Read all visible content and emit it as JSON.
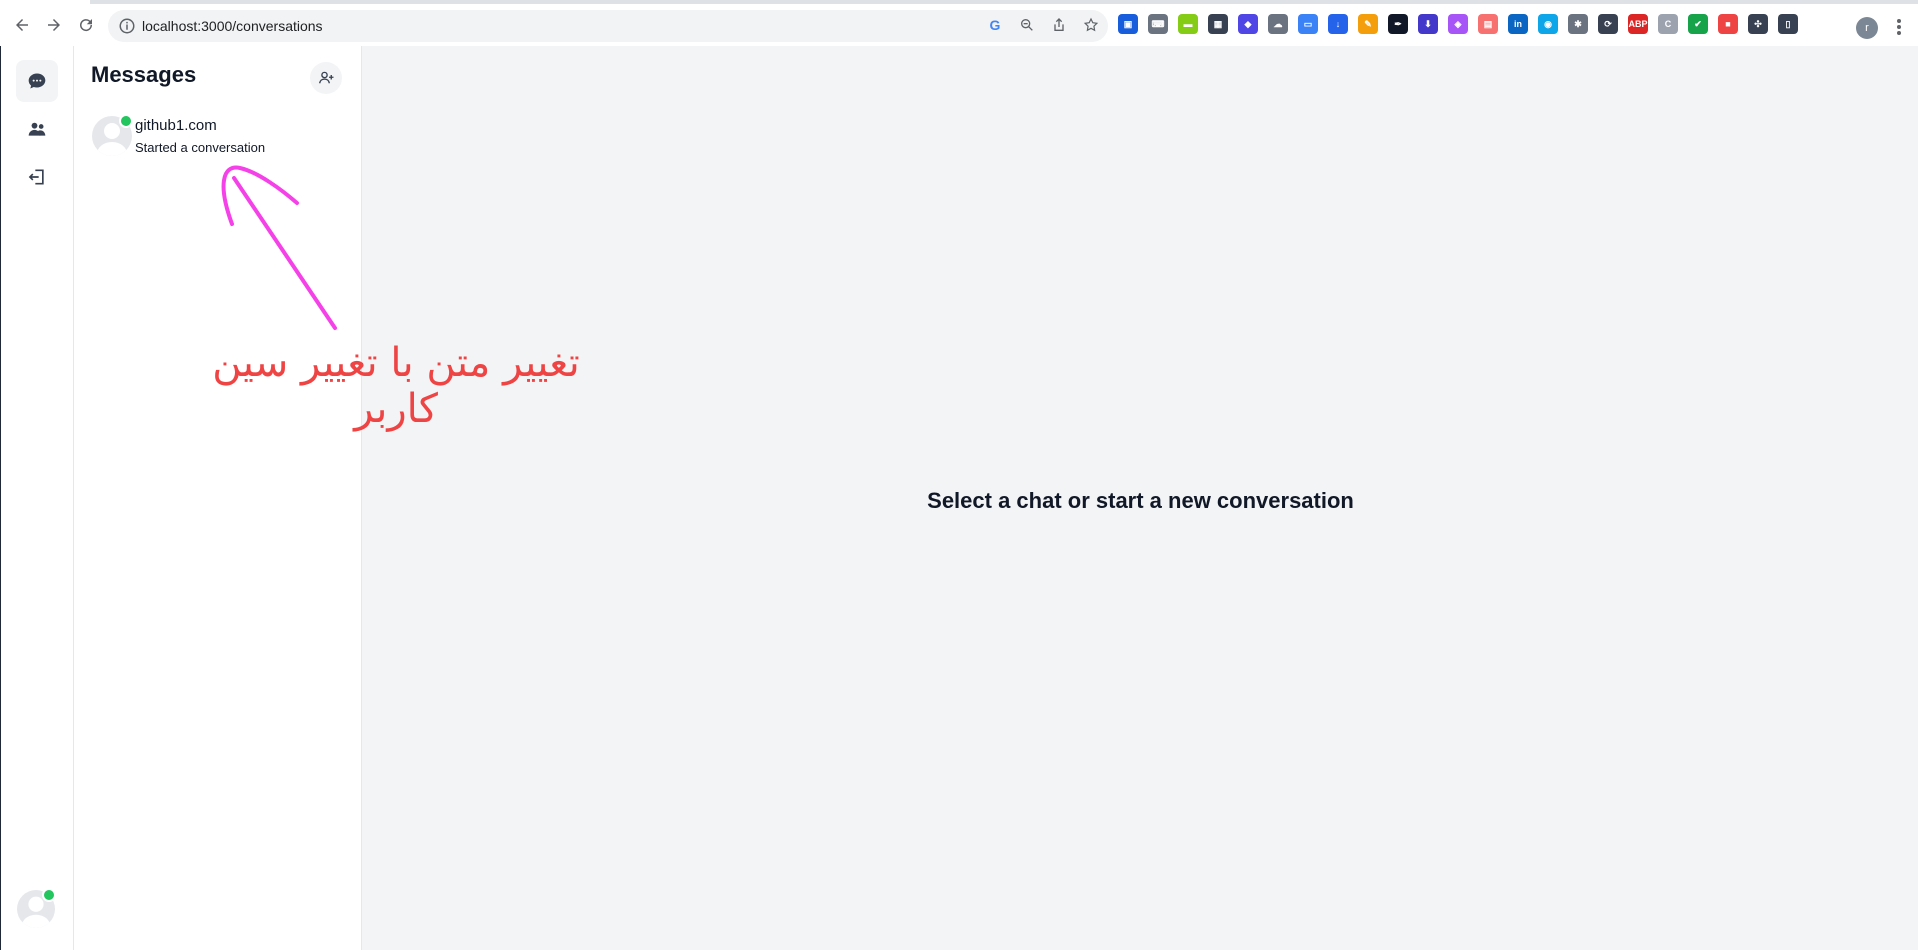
{
  "browser": {
    "url": "localhost:3000/conversations",
    "profile_initial": "r",
    "extensions": [
      {
        "icon": "bitwarden-icon",
        "color": "#175ddc",
        "glyph": "▣"
      },
      {
        "icon": "keyboard-icon",
        "color": "#6b7280",
        "glyph": "⌨"
      },
      {
        "icon": "grass-icon",
        "color": "#84cc16",
        "glyph": "▬"
      },
      {
        "icon": "qr-code-icon",
        "color": "#374151",
        "glyph": "▦"
      },
      {
        "icon": "cube-icon",
        "color": "#4f46e5",
        "glyph": "◆"
      },
      {
        "icon": "cloud-off-icon",
        "color": "#6b7280",
        "glyph": "☁"
      },
      {
        "icon": "window-icon",
        "color": "#3b82f6",
        "glyph": "▭"
      },
      {
        "icon": "download-icon",
        "color": "#2563eb",
        "glyph": "↓"
      },
      {
        "icon": "pencil-icon",
        "color": "#f59e0b",
        "glyph": "✎"
      },
      {
        "icon": "eyedropper-icon",
        "color": "#111827",
        "glyph": "✒"
      },
      {
        "icon": "save-icon",
        "color": "#4338ca",
        "glyph": "⬇"
      },
      {
        "icon": "gem-icon",
        "color": "#a855f7",
        "glyph": "◈"
      },
      {
        "icon": "calendar-icon",
        "color": "#f87171",
        "glyph": "▤"
      },
      {
        "icon": "linkedin-icon",
        "color": "#0a66c2",
        "glyph": "in"
      },
      {
        "icon": "screenshot-icon",
        "color": "#0ea5e9",
        "glyph": "◉"
      },
      {
        "icon": "bug-icon",
        "color": "#6b7280",
        "glyph": "✱"
      },
      {
        "icon": "sync-icon",
        "color": "#374151",
        "glyph": "⟳"
      },
      {
        "icon": "adblock-icon",
        "color": "#dc2626",
        "glyph": "ABP"
      },
      {
        "icon": "tag-icon",
        "color": "#9ca3af",
        "glyph": "C"
      },
      {
        "icon": "shield-icon",
        "color": "#16a34a",
        "glyph": "✔"
      },
      {
        "icon": "video-off-icon",
        "color": "#ef4444",
        "glyph": "■"
      },
      {
        "icon": "puzzle-icon",
        "color": "#374151",
        "glyph": "✣"
      },
      {
        "icon": "sidepanel-icon",
        "color": "#374151",
        "glyph": "▯"
      }
    ]
  },
  "sidebar": {
    "nav": [
      {
        "icon": "chat-icon",
        "active": true
      },
      {
        "icon": "users-icon",
        "active": false
      },
      {
        "icon": "logout-icon",
        "active": false
      }
    ],
    "user_online": true
  },
  "conversations": {
    "title": "Messages",
    "items": [
      {
        "name": "github1.com",
        "last_message": "Started a conversation",
        "online": true
      }
    ]
  },
  "chat": {
    "empty_text": "Select a chat or start a new conversation"
  },
  "annotation": {
    "text": "تغییر متن با تغییر سین کاربر",
    "arrow_color": "#f542e8",
    "text_color": "#ef4444"
  }
}
